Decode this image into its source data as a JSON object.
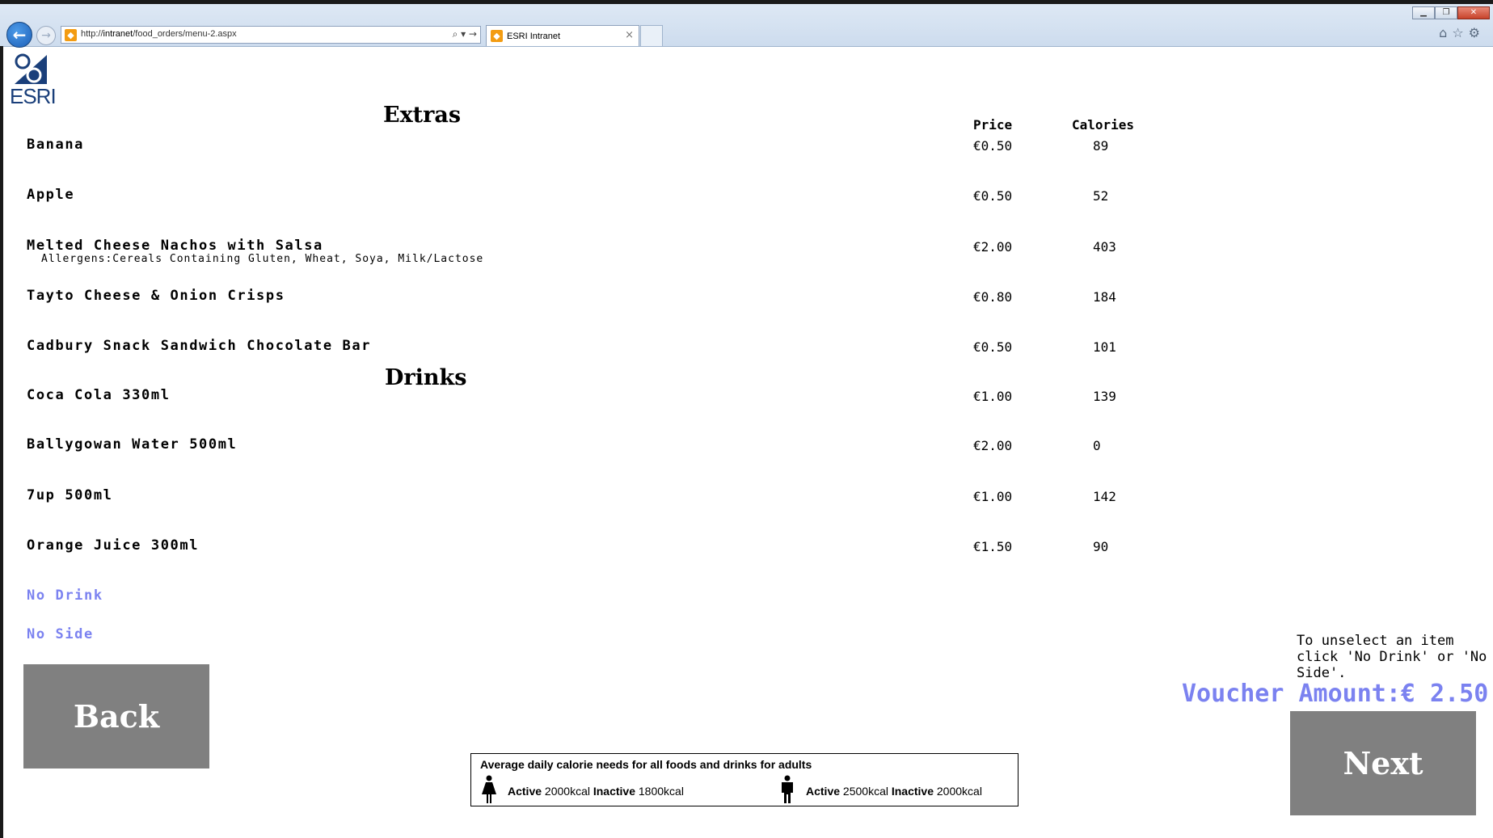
{
  "browser": {
    "url": "http://intranet/food_orders/menu-2.aspx",
    "url_prefix": "http://",
    "url_host": "intranet",
    "url_path": "/food_orders/menu-2.aspx",
    "tab_title": "ESRI Intranet",
    "tab_close": "×",
    "address_tools": "⌕ ▾ →"
  },
  "logo": {
    "text": "ESRI"
  },
  "sections": {
    "extras_title": "Extras",
    "drinks_title": "Drinks"
  },
  "columns": {
    "price": "Price",
    "calories": "Calories"
  },
  "extras": [
    {
      "name": "Banana",
      "price": "€0.50",
      "calories": "89"
    },
    {
      "name": "Apple",
      "price": "€0.50",
      "calories": "52"
    },
    {
      "name": "Melted Cheese Nachos with Salsa",
      "allergens": "Allergens:Cereals Containing Gluten, Wheat, Soya, Milk/Lactose",
      "price": "€2.00",
      "calories": "403"
    },
    {
      "name": "Tayto Cheese & Onion Crisps",
      "price": "€0.80",
      "calories": "184"
    },
    {
      "name": "Cadbury Snack Sandwich Chocolate Bar",
      "price": "€0.50",
      "calories": "101"
    }
  ],
  "drinks": [
    {
      "name": "Coca Cola 330ml",
      "price": "€1.00",
      "calories": "139"
    },
    {
      "name": "Ballygowan Water 500ml",
      "price": "€2.00",
      "calories": "0"
    },
    {
      "name": "7up 500ml",
      "price": "€1.00",
      "calories": "142"
    },
    {
      "name": "Orange Juice 300ml",
      "price": "€1.50",
      "calories": "90"
    }
  ],
  "options": {
    "no_drink": "No Drink",
    "no_side": "No Side"
  },
  "buttons": {
    "back": "Back",
    "next": "Next"
  },
  "hint_text": "To unselect an item click 'No Drink' or 'No Side'.",
  "voucher": "Voucher Amount:€ 2.50",
  "calorie_box": {
    "title": "Average daily calorie needs for all foods and drinks for adults",
    "female": {
      "active_label": "Active",
      "active_value": "2000kcal",
      "inactive_label": "Inactive",
      "inactive_value": "1800kcal"
    },
    "male": {
      "active_label": "Active",
      "active_value": "2500kcal",
      "inactive_label": "Inactive",
      "inactive_value": "2000kcal"
    }
  },
  "colors": {
    "link_accent": "#7b82f0",
    "button_gray": "#808080"
  }
}
